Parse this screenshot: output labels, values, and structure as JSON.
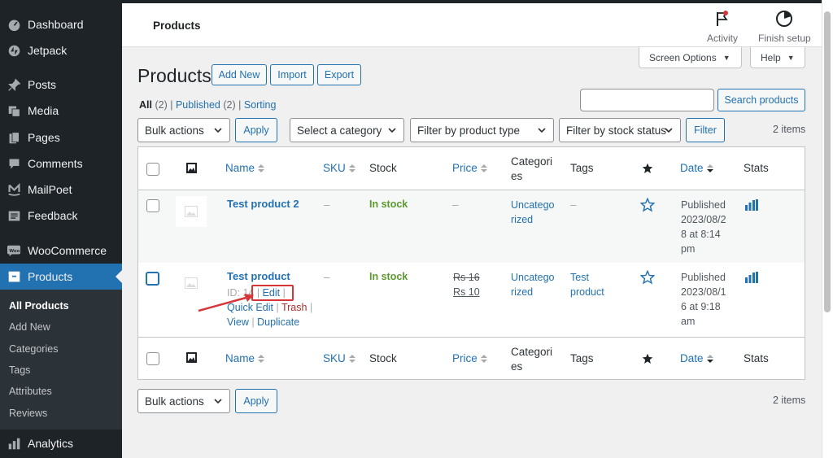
{
  "sidebar": {
    "items": [
      {
        "label": "Dashboard",
        "icon": "dashboard-icon"
      },
      {
        "label": "Jetpack",
        "icon": "jetpack-icon"
      },
      {
        "label": "Posts",
        "icon": "pin-icon"
      },
      {
        "label": "Media",
        "icon": "media-icon"
      },
      {
        "label": "Pages",
        "icon": "pages-icon"
      },
      {
        "label": "Comments",
        "icon": "comment-icon"
      },
      {
        "label": "MailPoet",
        "icon": "mailpoet-icon"
      },
      {
        "label": "Feedback",
        "icon": "feedback-icon"
      },
      {
        "label": "WooCommerce",
        "icon": "woocommerce-icon"
      },
      {
        "label": "Products",
        "icon": "products-icon"
      },
      {
        "label": "Analytics",
        "icon": "analytics-icon"
      }
    ],
    "submenu": [
      "All Products",
      "Add New",
      "Categories",
      "Tags",
      "Attributes",
      "Reviews"
    ]
  },
  "topbar": {
    "title": "Products",
    "activity_label": "Activity",
    "finish_setup_label": "Finish setup"
  },
  "tabs": {
    "screen_options": "Screen Options",
    "help": "Help"
  },
  "page": {
    "heading": "Products",
    "add_new": "Add New",
    "import": "Import",
    "export": "Export"
  },
  "views": {
    "all": "All",
    "all_count": "(2)",
    "published": "Published",
    "published_count": "(2)",
    "sorting": "Sorting",
    "sep": "|"
  },
  "search": {
    "value": "",
    "button": "Search products"
  },
  "filters": {
    "bulk_actions": "Bulk actions",
    "apply": "Apply",
    "category": "Select a category",
    "product_type": "Filter by product type",
    "stock_status": "Filter by stock status",
    "filter_button": "Filter",
    "items_count": "2 items"
  },
  "table": {
    "columns": {
      "name": "Name",
      "sku": "SKU",
      "stock": "Stock",
      "price": "Price",
      "categories_1": "Categori",
      "categories_2": "es",
      "tags": "Tags",
      "date": "Date",
      "stats": "Stats"
    },
    "rows": [
      {
        "name": "Test product 2",
        "sku": "–",
        "stock": "In stock",
        "price": "–",
        "category_1": "Uncatego",
        "category_2": "rized",
        "tags": "–",
        "date_1": "Published",
        "date_2": "2023/08/2",
        "date_3": "8 at 8:14",
        "date_4": "pm"
      },
      {
        "name": "Test product",
        "sku": "–",
        "stock": "In stock",
        "price_old": "Rs 16",
        "price_new": "Rs 10",
        "category_1": "Uncatego",
        "category_2": "rized",
        "tags_1": "Test",
        "tags_2": "product",
        "date_1": "Published",
        "date_2": "2023/08/1",
        "date_3": "6 at 9:18",
        "date_4": "am",
        "row_actions": {
          "id": "ID: 14",
          "edit": "Edit",
          "quick_edit": "Quick Edit",
          "trash": "Trash",
          "view": "View",
          "duplicate": "Duplicate",
          "sep": "|"
        }
      }
    ]
  },
  "colors": {
    "admin_menu_bg": "#1d2327",
    "accent": "#2271b1",
    "in_stock": "#5b9a2e",
    "trash": "#b32d2e",
    "annotation": "#d63638"
  }
}
